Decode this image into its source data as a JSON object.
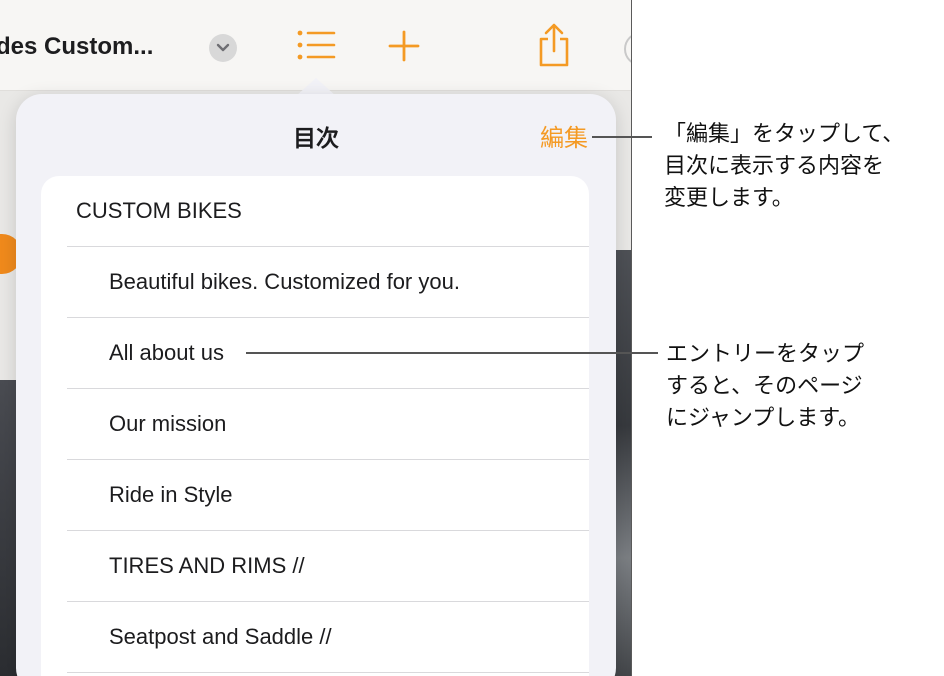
{
  "toolbar": {
    "doc_title": "des Custom...",
    "icons": [
      "chevron-down-icon",
      "list-icon",
      "plus-icon",
      "share-icon"
    ],
    "accent_color": "#f49a24"
  },
  "toc_popover": {
    "title": "目次",
    "edit_label": "編集",
    "entries": [
      {
        "label": "CUSTOM  BIKES",
        "level": 1
      },
      {
        "label": "Beautiful bikes. Customized for you.",
        "level": 2
      },
      {
        "label": "All about us",
        "level": 2
      },
      {
        "label": "Our mission",
        "level": 2
      },
      {
        "label": "Ride in Style",
        "level": 2
      },
      {
        "label": "TIRES AND RIMS //",
        "level": 2
      },
      {
        "label": "Seatpost and Saddle //",
        "level": 2
      }
    ]
  },
  "callouts": {
    "edit": [
      "「編集」をタップして、",
      "目次に表示する内容を",
      "変更します。"
    ],
    "entry": [
      "エントリーをタップ",
      "すると、そのページ",
      "にジャンプします。"
    ]
  }
}
